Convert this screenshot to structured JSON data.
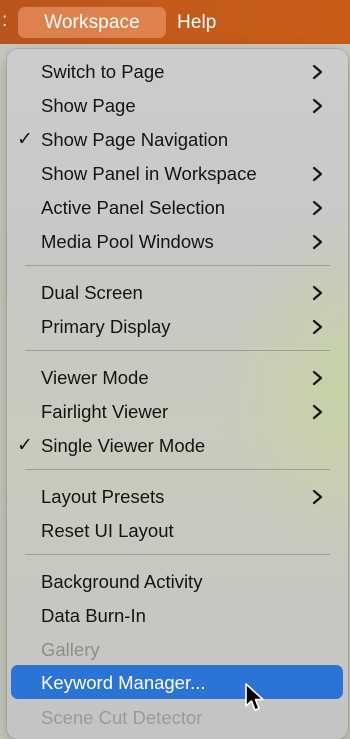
{
  "menubar": {
    "edge_glyph": ":",
    "workspace_label": "Workspace",
    "help_label": "Help"
  },
  "menu": {
    "items": [
      {
        "label": "Switch to Page",
        "submenu": true,
        "checked": false
      },
      {
        "label": "Show Page",
        "submenu": true,
        "checked": false
      },
      {
        "label": "Show Page Navigation",
        "submenu": false,
        "checked": true
      },
      {
        "label": "Show Panel in Workspace",
        "submenu": true,
        "checked": false
      },
      {
        "label": "Active Panel Selection",
        "submenu": true,
        "checked": false
      },
      {
        "label": "Media Pool Windows",
        "submenu": true,
        "checked": false
      },
      {
        "label": "Dual Screen",
        "submenu": true,
        "checked": false
      },
      {
        "label": "Primary Display",
        "submenu": true,
        "checked": false
      },
      {
        "label": "Viewer Mode",
        "submenu": true,
        "checked": false
      },
      {
        "label": "Fairlight Viewer",
        "submenu": true,
        "checked": false
      },
      {
        "label": "Single Viewer Mode",
        "submenu": false,
        "checked": true
      },
      {
        "label": "Layout Presets",
        "submenu": true,
        "checked": false
      },
      {
        "label": "Reset UI Layout",
        "submenu": false,
        "checked": false
      },
      {
        "label": "Background Activity",
        "submenu": false,
        "checked": false
      },
      {
        "label": "Data Burn-In",
        "submenu": false,
        "checked": false
      },
      {
        "label": "Gallery",
        "submenu": false,
        "checked": false,
        "disabled": true
      },
      {
        "label": "Keyword Manager...",
        "submenu": false,
        "checked": false,
        "highlighted": true
      },
      {
        "label": "Scene Cut Detector",
        "submenu": false,
        "checked": false
      }
    ],
    "check_glyph": "✓"
  },
  "colors": {
    "menubar": "#c35a1b",
    "highlight": "#2c73d6"
  },
  "icons": {
    "submenu": "chevron-right-icon",
    "check": "checkmark-icon",
    "cursor": "mouse-pointer-icon"
  }
}
